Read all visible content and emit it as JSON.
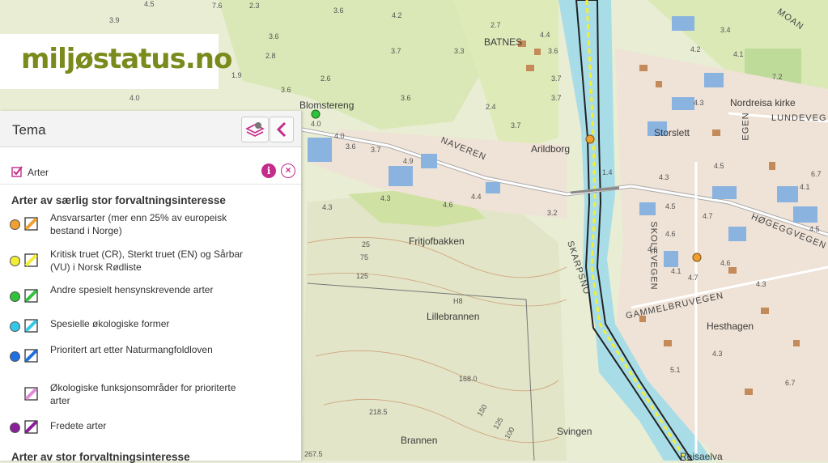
{
  "app": {
    "logo_text": "miljøstatus.no"
  },
  "panel": {
    "title": "Tema",
    "layer": {
      "name": "Arter",
      "checked": true,
      "info_label": "i",
      "remove_label": "×"
    },
    "section1_title": "Arter av særlig stor forvaltningsinteresse",
    "section2_title": "Arter av stor forvaltningsinteresse",
    "legend": [
      {
        "label": "Ansvarsarter (mer enn 25% av europeisk bestand i Norge)",
        "color": "#f0a030",
        "has_dot": true
      },
      {
        "label": "Kritisk truet (CR), Sterkt truet (EN) og Sårbar (VU) i Norsk Rødliste",
        "color": "#f2ee33",
        "has_dot": true
      },
      {
        "label": "Andre spesielt hensynskrevende arter",
        "color": "#2fc23a",
        "has_dot": true
      },
      {
        "label": "Spesielle økologiske former",
        "color": "#33c8e8",
        "has_dot": true
      },
      {
        "label": "Prioritert art etter Naturmangfoldloven",
        "color": "#1f70e0",
        "has_dot": true
      },
      {
        "label": "Økologiske funksjonsområder for prioriterte arter",
        "color": "#e08ad8",
        "has_dot": false
      },
      {
        "label": "Fredete arter",
        "color": "#8a1d99",
        "has_dot": true
      }
    ]
  },
  "map": {
    "places": [
      {
        "text": "Blomstereng",
        "cls": "place"
      },
      {
        "text": "BATNES",
        "cls": "place"
      },
      {
        "text": "Arildborg",
        "cls": "place"
      },
      {
        "text": "Storslett",
        "cls": "place"
      },
      {
        "text": "Nordreisa kirke",
        "cls": "place"
      },
      {
        "text": "Fritjofbakken",
        "cls": "place"
      },
      {
        "text": "Lillebrannen",
        "cls": "place"
      },
      {
        "text": "Hesthagen",
        "cls": "place"
      },
      {
        "text": "Svingen",
        "cls": "place"
      },
      {
        "text": "Brannen",
        "cls": "place"
      },
      {
        "text": "Reisaelva",
        "cls": "place"
      }
    ],
    "streets": [
      {
        "text": "NAVEREN"
      },
      {
        "text": "SKARPSNO"
      },
      {
        "text": "SKOLEVEGEN"
      },
      {
        "text": "GAMMELBRUVEGEN"
      },
      {
        "text": "HØGEGGVEGEN"
      },
      {
        "text": "LUNDEVEG"
      },
      {
        "text": "EGEN"
      },
      {
        "text": "MOAN"
      }
    ],
    "numbers": [
      "3.9",
      "4.5",
      "7.6",
      "2.3",
      "3.6",
      "4.2",
      "2.7",
      "3.4",
      "3.6",
      "4.4",
      "2.8",
      "3.7",
      "3.3",
      "3.6",
      "4.2",
      "4.1",
      "1.9",
      "2.6",
      "3.7",
      "7.2",
      "4.0",
      "3.6",
      "3.6",
      "3.7",
      "2.4",
      "4.3",
      "3.7",
      "4.0",
      "4.0",
      "3.6",
      "3.7",
      "1.4",
      "4.3",
      "4.9",
      "4.5",
      "6.7",
      "4.1",
      "4.4",
      "4.3",
      "3.2",
      "4.6",
      "4.5",
      "4.7",
      "4.6",
      "4.5",
      "4.6",
      "4.1",
      "4.7",
      "4.3",
      "4.3",
      "5.1",
      "6.7",
      "25",
      "75",
      "125",
      "H8",
      "168.0",
      "218.5",
      "150",
      "125",
      "100",
      "267.5",
      "4.3",
      "4.6"
    ]
  }
}
